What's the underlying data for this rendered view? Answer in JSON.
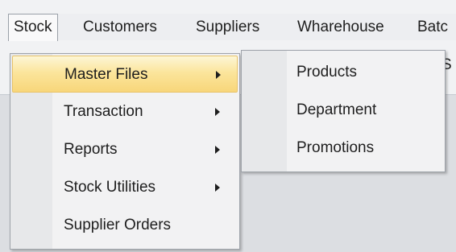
{
  "menubar": {
    "items": [
      {
        "label": "Stock",
        "open": true
      },
      {
        "label": "Customers"
      },
      {
        "label": "Suppliers"
      },
      {
        "label": "Wharehouse"
      },
      {
        "label": "Batc"
      }
    ]
  },
  "background": {
    "partial_text": "S"
  },
  "stock_menu": {
    "items": [
      {
        "label": "Master Files",
        "has_submenu": true,
        "highlighted": true
      },
      {
        "label": "Transaction",
        "has_submenu": true
      },
      {
        "label": "Reports",
        "has_submenu": true
      },
      {
        "label": "Stock Utilities",
        "has_submenu": true
      },
      {
        "label": "Supplier Orders",
        "has_submenu": false
      }
    ]
  },
  "master_files_submenu": {
    "items": [
      {
        "label": "Products"
      },
      {
        "label": "Department"
      },
      {
        "label": "Promotions"
      }
    ]
  },
  "colors": {
    "highlight_top": "#fdf6d6",
    "highlight_bottom": "#f8d67a",
    "highlight_border": "#e8c36a",
    "menu_background": "#f2f2f3",
    "menu_border": "#9ea3aa"
  }
}
